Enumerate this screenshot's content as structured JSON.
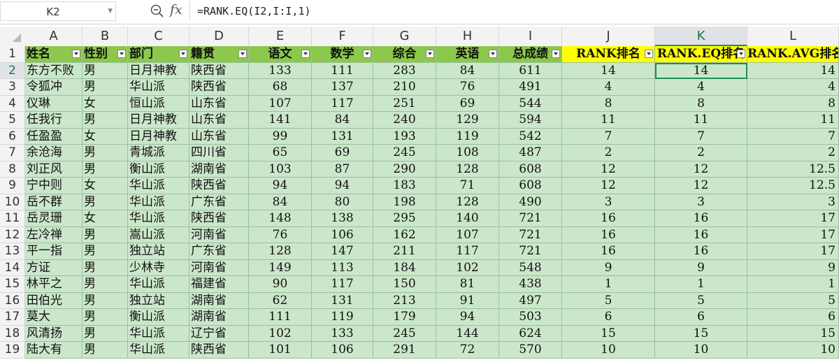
{
  "formula_bar": {
    "cell_ref": "K2",
    "formula": "=RANK.EQ(I2,I:I,1)",
    "fx_label": "fx"
  },
  "columns": [
    "A",
    "B",
    "C",
    "D",
    "E",
    "F",
    "G",
    "H",
    "I",
    "J",
    "K",
    "L"
  ],
  "selected_column": "K",
  "selected_row": 2,
  "active_cell": "K2",
  "header_row": [
    "姓名",
    "性别",
    "部门",
    "籍贯",
    "语文",
    "数学",
    "综合",
    "英语",
    "总成绩",
    "RANK排名",
    "RANK.EQ排名",
    "RANK.AVG排名"
  ],
  "rows": [
    [
      "东方不败",
      "男",
      "日月神教",
      "陕西省",
      "133",
      "111",
      "283",
      "84",
      "611",
      "14",
      "14",
      "14"
    ],
    [
      "令狐冲",
      "男",
      "华山派",
      "陕西省",
      "68",
      "137",
      "210",
      "76",
      "491",
      "4",
      "4",
      "4"
    ],
    [
      "仪琳",
      "女",
      "恒山派",
      "山东省",
      "107",
      "117",
      "251",
      "69",
      "544",
      "8",
      "8",
      "8"
    ],
    [
      "任我行",
      "男",
      "日月神教",
      "山东省",
      "141",
      "84",
      "240",
      "129",
      "594",
      "11",
      "11",
      "11"
    ],
    [
      "任盈盈",
      "女",
      "日月神教",
      "山东省",
      "99",
      "131",
      "193",
      "119",
      "542",
      "7",
      "7",
      "7"
    ],
    [
      "余沧海",
      "男",
      "青城派",
      "四川省",
      "65",
      "69",
      "245",
      "108",
      "487",
      "2",
      "2",
      "2"
    ],
    [
      "刘正风",
      "男",
      "衡山派",
      "湖南省",
      "103",
      "87",
      "290",
      "128",
      "608",
      "12",
      "12",
      "12.5"
    ],
    [
      "宁中则",
      "女",
      "华山派",
      "陕西省",
      "94",
      "94",
      "183",
      "71",
      "608",
      "12",
      "12",
      "12.5"
    ],
    [
      "岳不群",
      "男",
      "华山派",
      "广东省",
      "84",
      "80",
      "198",
      "128",
      "490",
      "3",
      "3",
      "3"
    ],
    [
      "岳灵珊",
      "女",
      "华山派",
      "陕西省",
      "148",
      "138",
      "295",
      "140",
      "721",
      "16",
      "16",
      "17"
    ],
    [
      "左冷禅",
      "男",
      "嵩山派",
      "河南省",
      "76",
      "106",
      "162",
      "107",
      "721",
      "16",
      "16",
      "17"
    ],
    [
      "平一指",
      "男",
      "独立站",
      "广东省",
      "128",
      "147",
      "211",
      "117",
      "721",
      "16",
      "16",
      "17"
    ],
    [
      "方证",
      "男",
      "少林寺",
      "河南省",
      "149",
      "113",
      "184",
      "102",
      "548",
      "9",
      "9",
      "9"
    ],
    [
      "林平之",
      "男",
      "华山派",
      "福建省",
      "90",
      "117",
      "150",
      "81",
      "438",
      "1",
      "1",
      "1"
    ],
    [
      "田伯光",
      "男",
      "独立站",
      "湖南省",
      "62",
      "131",
      "213",
      "91",
      "497",
      "5",
      "5",
      "5"
    ],
    [
      "莫大",
      "男",
      "衡山派",
      "湖南省",
      "111",
      "119",
      "179",
      "94",
      "503",
      "6",
      "6",
      "6"
    ],
    [
      "风清扬",
      "男",
      "华山派",
      "辽宁省",
      "102",
      "133",
      "245",
      "144",
      "624",
      "15",
      "15",
      "15"
    ],
    [
      "陆大有",
      "男",
      "华山派",
      "陕西省",
      "101",
      "106",
      "291",
      "72",
      "570",
      "10",
      "10",
      "10"
    ]
  ],
  "colors": {
    "header_green": "#8cc84b",
    "header_yellow": "#ffff00",
    "cell_green": "#cbe7cb",
    "selection": "#1f8f55"
  }
}
